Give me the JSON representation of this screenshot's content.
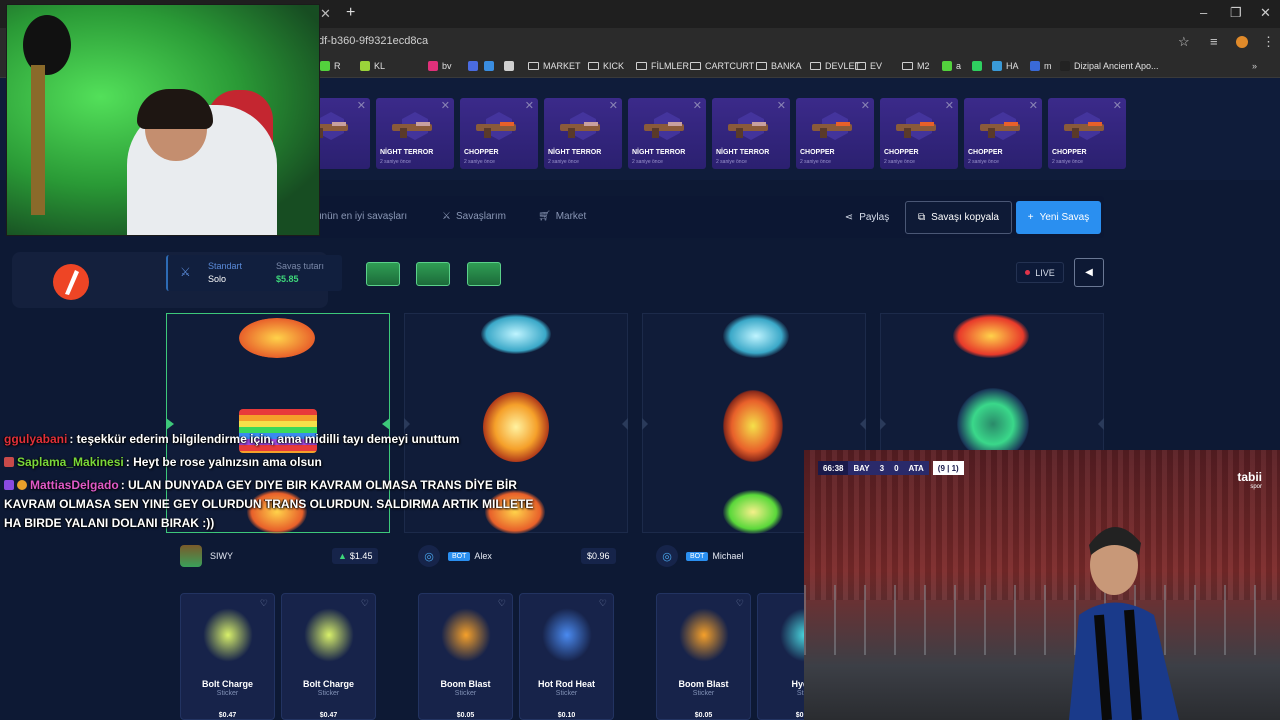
{
  "browser": {
    "url": "df-b360-9f9321ecd8ca",
    "bookmarks": [
      {
        "label": "R",
        "color": "#53d23d"
      },
      {
        "label": "KL",
        "color": "#9bd43a"
      },
      {
        "label": "bv",
        "color": "#e0307a"
      },
      {
        "label": "",
        "color": "#4a6be0"
      },
      {
        "label": "",
        "color": "#3a8de0"
      },
      {
        "label": "",
        "color": "#cfcfcf"
      },
      {
        "label": "MARKET",
        "color": ""
      },
      {
        "label": "KICK",
        "color": ""
      },
      {
        "label": "FİLMLER",
        "color": ""
      },
      {
        "label": "CARTCURT",
        "color": ""
      },
      {
        "label": "BANKA",
        "color": ""
      },
      {
        "label": "DEVLET",
        "color": ""
      },
      {
        "label": "EV",
        "color": ""
      },
      {
        "label": "M2",
        "color": ""
      },
      {
        "label": "a",
        "color": "#53d23d"
      },
      {
        "label": "",
        "color": "#2fd060"
      },
      {
        "label": "HA",
        "color": "#3a9ad8"
      },
      {
        "label": "m",
        "color": "#3a6ad8"
      },
      {
        "label": "Dizipal Ancient Apo...",
        "color": "#222"
      }
    ]
  },
  "drops": [
    {
      "name": "L",
      "sub": ""
    },
    {
      "name": "NİGHT TERROR",
      "sub": "2 saniye önce"
    },
    {
      "name": "CHOPPER",
      "sub": "2 saniye önce"
    },
    {
      "name": "NİGHT TERROR",
      "sub": "2 saniye önce"
    },
    {
      "name": "NİGHT TERROR",
      "sub": "2 saniye önce"
    },
    {
      "name": "NİGHT TERROR",
      "sub": "2 saniye önce"
    },
    {
      "name": "CHOPPER",
      "sub": "2 saniye önce"
    },
    {
      "name": "CHOPPER",
      "sub": "2 saniye önce"
    },
    {
      "name": "CHOPPER",
      "sub": "2 saniye önce"
    },
    {
      "name": "CHOPPER",
      "sub": "2 saniye önce"
    }
  ],
  "nav": {
    "best_battles": "ünün en iyi savaşları",
    "my_battles": "Savaşlarım",
    "market": "Market",
    "share": "Paylaş",
    "copy": "Savaşı kopyala",
    "new": "Yeni Savaş"
  },
  "battle": {
    "mode_label": "Standart",
    "mode_value": "Solo",
    "cost_label": "Savaş tutarı",
    "cost_value": "$5.85",
    "live_label": "LIVE"
  },
  "players": [
    {
      "name": "SIWY",
      "bot": false,
      "price": "$1.45",
      "up": true
    },
    {
      "name": "Alex",
      "bot": true,
      "price": "$0.96",
      "up": false
    },
    {
      "name": "Michael",
      "bot": true,
      "price": "",
      "up": false
    }
  ],
  "cards": [
    {
      "name": "Bolt Charge",
      "type": "Sticker",
      "price": "$0.47",
      "color": "#d8f06a"
    },
    {
      "name": "Bolt Charge",
      "type": "Sticker",
      "price": "$0.47",
      "color": "#d8f06a"
    },
    {
      "name": "Boom Blast",
      "type": "Sticker",
      "price": "$0.05",
      "color": "#f5a02a"
    },
    {
      "name": "Hot Rod Heat",
      "type": "Sticker",
      "price": "$0.10",
      "color": "#4a8af0"
    },
    {
      "name": "Boom Blast",
      "type": "Sticker",
      "price": "$0.05",
      "color": "#f5a02a"
    },
    {
      "name": "Hydro",
      "type": "Stick",
      "price": "$0.30",
      "color": "#4ad8e0"
    }
  ],
  "chat": [
    {
      "user": "ggulyabani",
      "user_color": "#e0303a",
      "text": ": teşekkür ederim bilgilendirme için, ama midilli tayı demeyi unuttum"
    },
    {
      "user": "Saplama_Makinesi",
      "user_color": "#7ad83a",
      "text": ": Heyt be rose yalnızsın ama olsun"
    },
    {
      "user": "MattiasDelgado",
      "user_color": "#e05ac8",
      "text": ": ULAN DUNYADA GEY DIYE BIR KAVRAM OLMASA TRANS DİYE BİR"
    },
    {
      "user": "",
      "user_color": "",
      "text": "KAVRAM OLMASA SEN YINE GEY OLURDUN TRANS OLURDUN. SALDIRMA ARTIK MILLETE"
    },
    {
      "user": "",
      "user_color": "",
      "text": "HA BIRDE YALANI DOLANI BIRAK :))"
    }
  ],
  "tv": {
    "time": "66:38",
    "home": "BAY",
    "home_score": "3",
    "away_score": "0",
    "away": "ATA",
    "agg": "(9 | 1)",
    "brand": "tabii",
    "brand_sub": "spor"
  }
}
